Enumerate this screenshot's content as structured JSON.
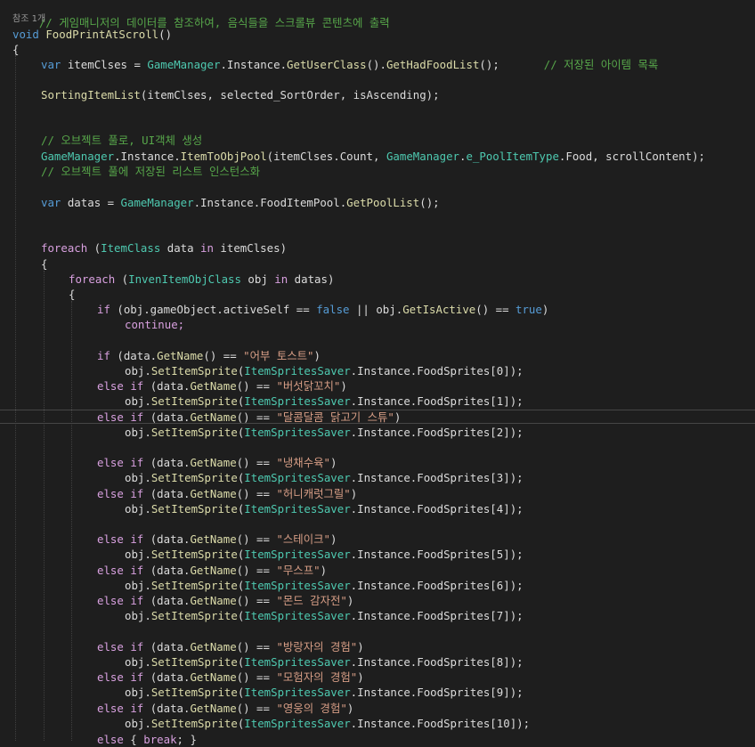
{
  "editor": {
    "comment_header": "// 게임매니저의 데이터를 참조하여, 음식들을 스크롤뷰 콘텐츠에 출력",
    "codelens": "참조 1개",
    "method": {
      "modifier": "void",
      "name": "FoodPrintAtScroll",
      "params": "()"
    },
    "lines": {
      "open_brace": "{",
      "var_items": {
        "kw": "var",
        "name": " itemClses = ",
        "t1": "GameManager",
        "p1": ".Instance.",
        "m1": "GetUserClass",
        "p2": "().",
        "m2": "GetHadFoodList",
        "p3": "();",
        "comment": "// 저장된 아이템 목록"
      },
      "sorting": {
        "m": "SortingItemList",
        "rest": "(itemClses, selected_SortOrder, isAscending);"
      },
      "comment_pool": "// 오브젝트 풀로, UI객체 생성",
      "pool_call": {
        "t1": "GameManager",
        "p1": ".Instance.",
        "m1": "ItemToObjPool",
        "p2": "(itemClses.Count, ",
        "t2": "GameManager",
        "p3": ".",
        "t3": "e_PoolItemType",
        "p4": ".Food, scrollContent);"
      },
      "comment_list": "// 오브젝트 풀에 저장된 리스트 인스턴스화",
      "var_datas": {
        "kw": "var",
        "name": " datas = ",
        "t1": "GameManager",
        "p1": ".Instance.FoodItemPool.",
        "m1": "GetPoolList",
        "p2": "();"
      },
      "foreach1": {
        "kw": "foreach",
        "p1": " (",
        "t1": "ItemClass",
        "p2": " data ",
        "kw2": "in",
        "p3": " itemClses)"
      },
      "open_brace2": "{",
      "foreach2": {
        "kw": "foreach",
        "p1": " (",
        "t1": "InvenItemObjClass",
        "p2": " obj ",
        "kw2": "in",
        "p3": " datas)"
      },
      "open_brace3": "{",
      "if_active": {
        "kw": "if",
        "p1": " (obj.gameObject.activeSelf == ",
        "kw2": "false",
        "p2": " || obj.",
        "m1": "GetIsActive",
        "p3": "() == ",
        "kw3": "true",
        "p4": ")"
      },
      "continue": "continue;",
      "break_line": {
        "kw": "else",
        "p1": " { ",
        "kw2": "break",
        "p2": "; }"
      }
    },
    "foods": [
      {
        "name": "\"어부 토스트\"",
        "index": "0",
        "else": false
      },
      {
        "name": "\"버섯닭꼬치\"",
        "index": "1",
        "else": true
      },
      {
        "name": "\"달콤달콤 닭고기 스튜\"",
        "index": "2",
        "else": true
      },
      {
        "name": "\"냉채수육\"",
        "index": "3",
        "else": true
      },
      {
        "name": "\"허니캐럿그릴\"",
        "index": "4",
        "else": true
      },
      {
        "name": "\"스테이크\"",
        "index": "5",
        "else": true
      },
      {
        "name": "\"무스프\"",
        "index": "6",
        "else": true
      },
      {
        "name": "\"몬드 감자전\"",
        "index": "7",
        "else": true
      },
      {
        "name": "\"방랑자의 경험\"",
        "index": "8",
        "else": true
      },
      {
        "name": "\"모험자의 경험\"",
        "index": "9",
        "else": true
      },
      {
        "name": "\"영웅의 경험\"",
        "index": "10",
        "else": true
      }
    ],
    "tokens": {
      "if_kw": "if",
      "else_kw": "else",
      "cond_pre": " (data.",
      "getname": "GetName",
      "cond_mid": "() == ",
      "cond_end": ")",
      "obj_pre": "obj.",
      "setsprite": "SetItemSprite",
      "paren": "(",
      "saver": "ItemSpritesSaver",
      "saver_rest": ".Instance.FoodSprites[",
      "close": "]);"
    }
  },
  "colors": {
    "background": "#1e1e1e",
    "keyword": "#569cd6",
    "control": "#d8a0df",
    "type": "#4ec9b0",
    "comment": "#57a64a",
    "string": "#d69d85",
    "method": "#dcdcaa",
    "plain": "#dcdcdc"
  }
}
